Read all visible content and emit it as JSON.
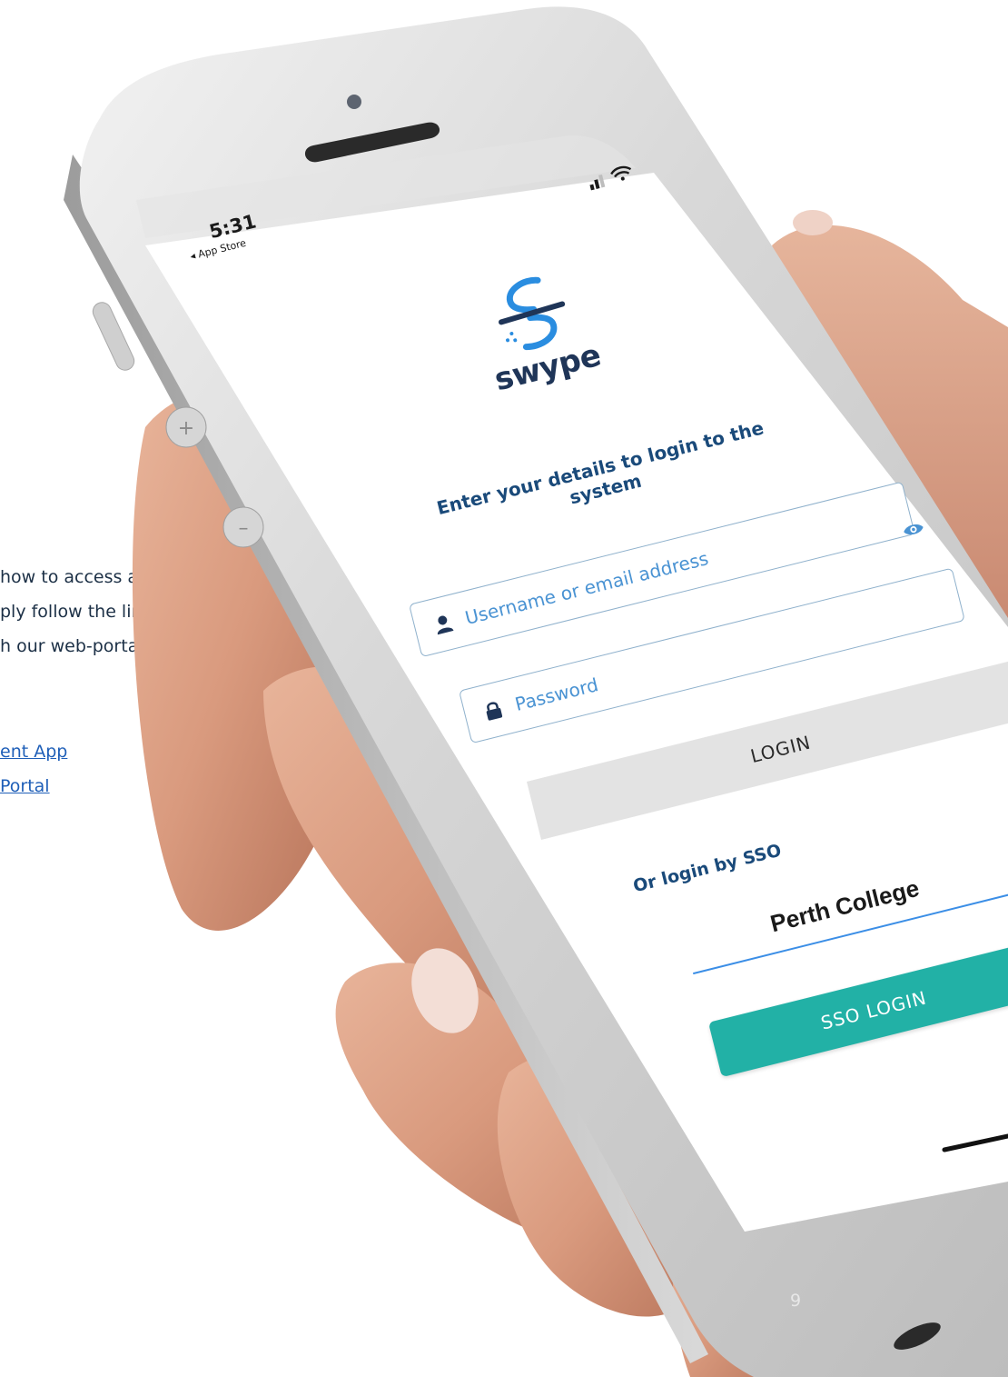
{
  "document": {
    "left_text": {
      "lines": [
        "how to access and",
        "ply follow the links",
        "h our web-portal and"
      ],
      "links": [
        "ent App",
        "Portal"
      ]
    },
    "page_number": "9"
  },
  "phone": {
    "status_bar": {
      "time": "5:31",
      "back_label": "◂ App Store",
      "icons": [
        "signal-icon",
        "wifi-icon"
      ]
    },
    "app": {
      "logo_text": "swype",
      "headline_line1": "Enter your details to login to the",
      "headline_line2": "system",
      "username_placeholder": "Username or email address",
      "password_placeholder": "Password",
      "login_label": "LOGIN",
      "sso_prompt": "Or login by SSO",
      "sso_selected": "Perth College",
      "sso_button_label": "SSO LOGIN"
    }
  },
  "colors": {
    "brand_blue": "#1a4a7a",
    "accent_blue": "#4a93d3",
    "sso_teal": "#22b1a6",
    "link_blue": "#1f5fb8"
  }
}
